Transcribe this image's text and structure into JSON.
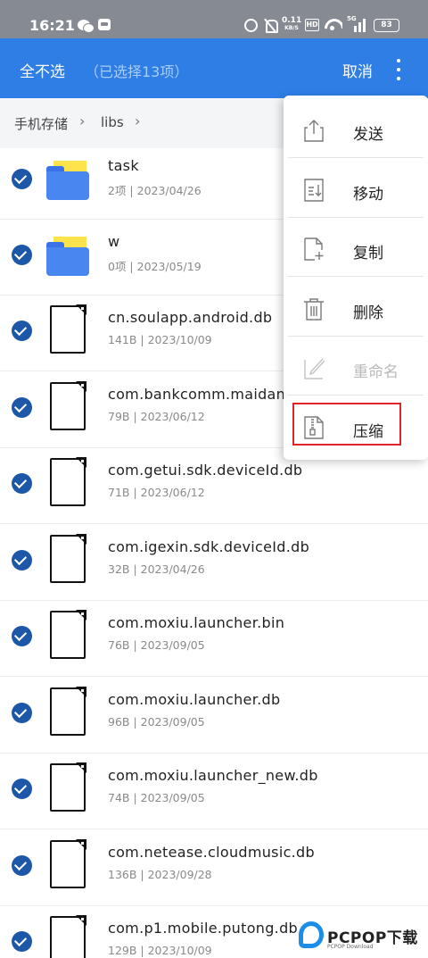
{
  "status_bar": {
    "time": "16:21",
    "net_speed_value": "0.11",
    "net_speed_unit": "KB/S",
    "hd_label": "HD",
    "signal_label": "5G",
    "battery": "83"
  },
  "app_bar": {
    "select_none_label": "全不选",
    "selected_count_label": "（已选择13项）",
    "cancel_label": "取消",
    "background_color": "#2e7ee6"
  },
  "breadcrumb": {
    "items": [
      "手机存储",
      "libs"
    ],
    "separator": "›"
  },
  "files": [
    {
      "name": "task",
      "meta": "2项 | 2023/04/26",
      "type": "folder-icon",
      "selected": true
    },
    {
      "name": "w",
      "meta": "0项 | 2023/05/19",
      "type": "folder-icon",
      "selected": true
    },
    {
      "name": "cn.soulapp.android.db",
      "meta": "141B | 2023/10/09",
      "type": "file-icon",
      "selected": true
    },
    {
      "name": "com.bankcomm.maidanba.db",
      "meta": "79B | 2023/06/12",
      "type": "file-icon",
      "selected": true
    },
    {
      "name": "com.getui.sdk.deviceId.db",
      "meta": "71B | 2023/06/12",
      "type": "file-icon",
      "selected": true
    },
    {
      "name": "com.igexin.sdk.deviceId.db",
      "meta": "32B | 2023/04/26",
      "type": "file-icon",
      "selected": true
    },
    {
      "name": "com.moxiu.launcher.bin",
      "meta": "76B | 2023/09/05",
      "type": "file-icon",
      "selected": true
    },
    {
      "name": "com.moxiu.launcher.db",
      "meta": "96B | 2023/09/05",
      "type": "file-icon",
      "selected": true
    },
    {
      "name": "com.moxiu.launcher_new.db",
      "meta": "74B | 2023/09/05",
      "type": "file-icon",
      "selected": true
    },
    {
      "name": "com.netease.cloudmusic.db",
      "meta": "136B | 2023/09/28",
      "type": "file-icon",
      "selected": true
    },
    {
      "name": "com.p1.mobile.putong.db",
      "meta": "129B | 2023/10/09",
      "type": "file-icon",
      "selected": true
    }
  ],
  "popup_menu": {
    "items": [
      {
        "label": "发送",
        "icon": "share-icon",
        "enabled": true
      },
      {
        "label": "移动",
        "icon": "move-icon",
        "enabled": true
      },
      {
        "label": "复制",
        "icon": "copy-icon",
        "enabled": true
      },
      {
        "label": "删除",
        "icon": "trash-icon",
        "enabled": true
      },
      {
        "label": "重命名",
        "icon": "rename-icon",
        "enabled": false
      },
      {
        "label": "压缩",
        "icon": "zip-icon",
        "enabled": true
      }
    ],
    "highlighted_item": "压缩",
    "highlight_color": "#e0252a"
  },
  "watermark": {
    "text": "PCPOP下载",
    "subtext": "PCPOP Download"
  }
}
